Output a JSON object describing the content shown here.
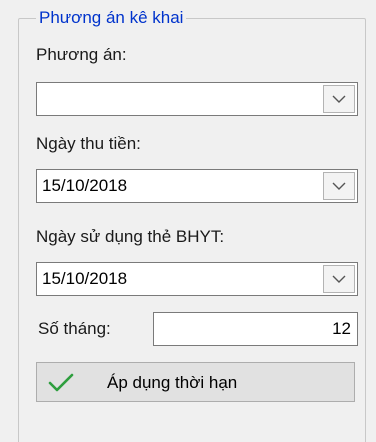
{
  "group": {
    "title": "Phương án kê khai",
    "plan_label": "Phương án:",
    "plan_value": "",
    "collect_date_label": "Ngày thu tiền:",
    "collect_date_value": "15/10/2018",
    "bhyt_date_label": "Ngày sử dụng thẻ BHYT:",
    "bhyt_date_value": "15/10/2018",
    "months_label": "Số tháng:",
    "months_value": "12",
    "apply_button_label": "Áp dụng thời hạn"
  },
  "icons": {
    "dropdown": "chevron-down-icon",
    "apply": "checkmark-icon"
  },
  "colors": {
    "legend_text": "#0033cc",
    "check_green": "#2e9e3e"
  }
}
